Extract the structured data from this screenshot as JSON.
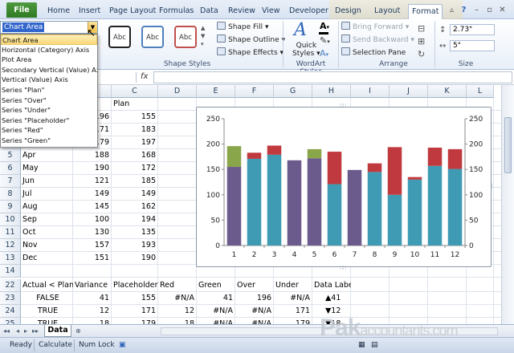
{
  "ribbon_tabs": [
    "File",
    "Home",
    "Insert",
    "Page Layout",
    "Formulas",
    "Data",
    "Review",
    "View",
    "Developer",
    "Design",
    "Layout",
    "Format"
  ],
  "active_tab": "Format",
  "ribbon": {
    "shape_styles_label": "Shape Styles",
    "abc_label": "Abc",
    "shape_fill": "Shape Fill",
    "shape_outline": "Shape Outline",
    "shape_effects": "Shape Effects",
    "quick_styles_line1": "Quick",
    "quick_styles_line2": "Styles",
    "wordart_label": "WordArt Styles",
    "bring_forward": "Bring Forward",
    "send_backward": "Send Backward",
    "selection_pane": "Selection Pane",
    "arrange_label": "Arrange",
    "height_value": "2.73\"",
    "width_value": "5\"",
    "size_label": "Size"
  },
  "namebox": {
    "value": "Chart Area"
  },
  "dropdown_items": [
    "Chart Area",
    "Horizontal (Category) Axis",
    "Plot Area",
    "Secondary Vertical (Value) Axis",
    "Vertical (Value) Axis",
    "Series \"Plan\"",
    "Series \"Over\"",
    "Series \"Under\"",
    "Series \"Placeholder\"",
    "Series \"Red\"",
    "Series \"Green\""
  ],
  "formula_bar": {
    "fx": "fx",
    "value": ""
  },
  "columns": [
    "A",
    "B",
    "C",
    "D",
    "E",
    "F",
    "G",
    "H",
    "I",
    "J",
    "K",
    "L"
  ],
  "rows": [
    {
      "n": "2",
      "a": "",
      "b": "",
      "c": "Plan"
    },
    {
      "n": "3",
      "a": "",
      "b": "196",
      "c": "155"
    },
    {
      "n": "4",
      "a": "",
      "b": "171",
      "c": "183"
    },
    {
      "n": "5",
      "a": "",
      "b": "179",
      "c": "197"
    },
    {
      "n": "5",
      "a": "Apr",
      "b": "188",
      "c": "168"
    },
    {
      "n": "6",
      "a": "May",
      "b": "190",
      "c": "172"
    },
    {
      "n": "7",
      "a": "Jun",
      "b": "121",
      "c": "185"
    },
    {
      "n": "8",
      "a": "Jul",
      "b": "149",
      "c": "149"
    },
    {
      "n": "9",
      "a": "Aug",
      "b": "145",
      "c": "162"
    },
    {
      "n": "10",
      "a": "Sep",
      "b": "100",
      "c": "194"
    },
    {
      "n": "11",
      "a": "Oct",
      "b": "130",
      "c": "135"
    },
    {
      "n": "12",
      "a": "Nov",
      "b": "157",
      "c": "193"
    },
    {
      "n": "13",
      "a": "Dec",
      "b": "151",
      "c": "190"
    },
    {
      "n": "14",
      "a": "",
      "b": "",
      "c": ""
    },
    {
      "n": "22",
      "a": "Actual < Plan",
      "b": "Variance",
      "c": "Placeholder",
      "d": "Red",
      "e": "Green",
      "f": "Over",
      "g": "Under",
      "h": "Data Labels"
    },
    {
      "n": "23",
      "a": "FALSE",
      "b": "41",
      "c": "155",
      "d": "#N/A",
      "e": "41",
      "f": "196",
      "g": "#N/A",
      "h": "▲41"
    },
    {
      "n": "24",
      "a": "TRUE",
      "b": "12",
      "c": "171",
      "d": "12",
      "e": "#N/A",
      "f": "#N/A",
      "g": "171",
      "h": "▼12"
    },
    {
      "n": "25",
      "a": "TRUE",
      "b": "18",
      "c": "179",
      "d": "18",
      "e": "#N/A",
      "f": "#N/A",
      "g": "179",
      "h": "▼18"
    }
  ],
  "chart_data": {
    "type": "bar",
    "stacked": true,
    "categories": [
      "1",
      "2",
      "3",
      "4",
      "5",
      "6",
      "7",
      "8",
      "9",
      "10",
      "11",
      "12"
    ],
    "series": [
      {
        "key": "base_purple",
        "color": "#6b5a8c",
        "values": [
          155,
          0,
          0,
          168,
          172,
          0,
          149,
          0,
          0,
          0,
          0,
          0
        ]
      },
      {
        "key": "base_teal",
        "color": "#3f9bb3",
        "values": [
          0,
          171,
          179,
          0,
          0,
          121,
          0,
          145,
          100,
          130,
          157,
          151
        ]
      },
      {
        "key": "green",
        "color": "#8aa64a",
        "values": [
          41,
          0,
          0,
          0,
          18,
          0,
          0,
          0,
          0,
          0,
          0,
          0
        ]
      },
      {
        "key": "red",
        "color": "#c0393e",
        "values": [
          0,
          12,
          18,
          0,
          0,
          64,
          0,
          17,
          94,
          5,
          36,
          39
        ]
      }
    ],
    "ylim": [
      0,
      250
    ],
    "yticks": [
      0,
      50,
      100,
      150,
      200,
      250
    ],
    "secondary_y": true,
    "grid": false
  },
  "sheet_tab": "Data",
  "status": {
    "ready": "Ready",
    "calculate": "Calculate",
    "numlock": "Num Lock"
  },
  "watermark": {
    "big": "Pak",
    "small": "accountants.com"
  }
}
